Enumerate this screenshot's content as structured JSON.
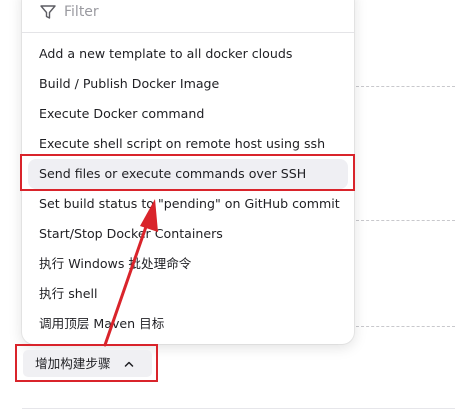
{
  "filter": {
    "placeholder": "Filter"
  },
  "menu": {
    "items": [
      {
        "label": "Add a new template to all docker clouds"
      },
      {
        "label": "Build / Publish Docker Image"
      },
      {
        "label": "Execute Docker command"
      },
      {
        "label": "Execute shell script on remote host using ssh"
      },
      {
        "label": "Send files or execute commands over SSH"
      },
      {
        "label": "Set build status to \"pending\" on GitHub commit"
      },
      {
        "label": "Start/Stop Docker Containers"
      },
      {
        "label": "执行 Windows 批处理命令"
      },
      {
        "label": "执行 shell"
      },
      {
        "label": "调用顶层 Maven 目标"
      }
    ]
  },
  "add_step": {
    "label": "增加构建步骤"
  },
  "colors": {
    "annotation": "#d9242b",
    "hover_bg": "#efeff3"
  },
  "icons": {
    "filter": "funnel-icon",
    "toggle": "chevron-up-icon"
  }
}
